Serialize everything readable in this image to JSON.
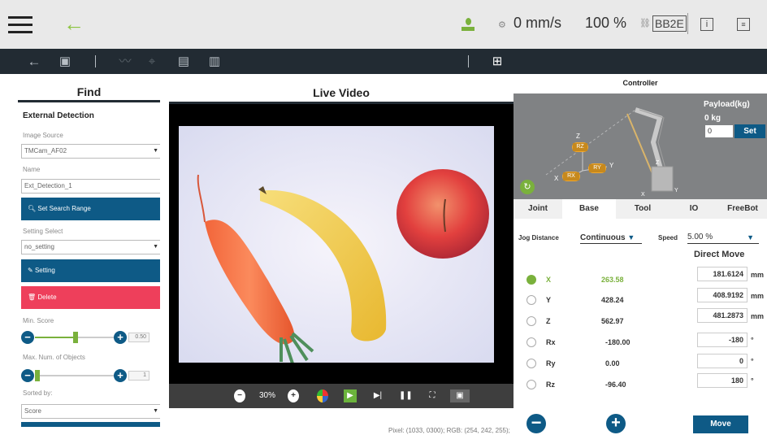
{
  "status": {
    "speed": "0 mm/s",
    "percent": "100 %",
    "badge": "BB2E"
  },
  "find_panel": {
    "title": "Find",
    "section": "External Detection",
    "image_source_label": "Image Source",
    "image_source_value": "TMCam_AF02",
    "name_label": "Name",
    "name_value": "Ext_Detection_1",
    "search_range_button": "Set Search Range",
    "setting_select_label": "Setting Select",
    "setting_select_value": "no_setting",
    "setting_button": "Setting",
    "delete_button": "Delete",
    "min_score_label": "Min. Score",
    "min_score_value": "0.50",
    "max_objects_label": "Max. Num. of Objects",
    "max_objects_value": "1",
    "sorted_by_label": "Sorted by:",
    "sorted_by_value": "Score"
  },
  "video": {
    "title": "Live Video",
    "zoom": "30%",
    "pixel_info": "Pixel: (1033, 0300); RGB: (254, 242, 255);"
  },
  "controller": {
    "title": "Controller",
    "payload_label": "Payload(kg)",
    "payload_current": "0 kg",
    "payload_input": "0",
    "set_button": "Set",
    "axis_labels": {
      "z": "Z",
      "x": "X",
      "y": "Y",
      "rz": "RZ",
      "rx": "RX",
      "ry": "RY",
      "y2": "Y",
      "x2": "X",
      "z2": "Z"
    },
    "tabs": [
      "Joint",
      "Base",
      "Tool",
      "IO",
      "FreeBot"
    ],
    "jog_distance_label": "Jog Distance",
    "jog_distance_value": "Continuous",
    "speed_label": "Speed",
    "speed_value": "5.00 %",
    "direct_move_label": "Direct Move",
    "move_button": "Move",
    "axes": [
      {
        "name": "X",
        "value": "263.58",
        "input": "181.6124",
        "unit": "mm",
        "selected": true
      },
      {
        "name": "Y",
        "value": "428.24",
        "input": "408.9192",
        "unit": "mm",
        "selected": false
      },
      {
        "name": "Z",
        "value": "562.97",
        "input": "481.2873",
        "unit": "mm",
        "selected": false
      },
      {
        "name": "Rx",
        "value": "-180.00",
        "input": "-180",
        "unit": "°",
        "selected": false
      },
      {
        "name": "Ry",
        "value": "0.00",
        "input": "0",
        "unit": "°",
        "selected": false
      },
      {
        "name": "Rz",
        "value": "-96.40",
        "input": "180",
        "unit": "°",
        "selected": false
      }
    ]
  },
  "colors": {
    "toolbar": "#222b33",
    "primary": "#0e5a86",
    "danger": "#ee3f5b",
    "accent": "#7ab13c"
  }
}
